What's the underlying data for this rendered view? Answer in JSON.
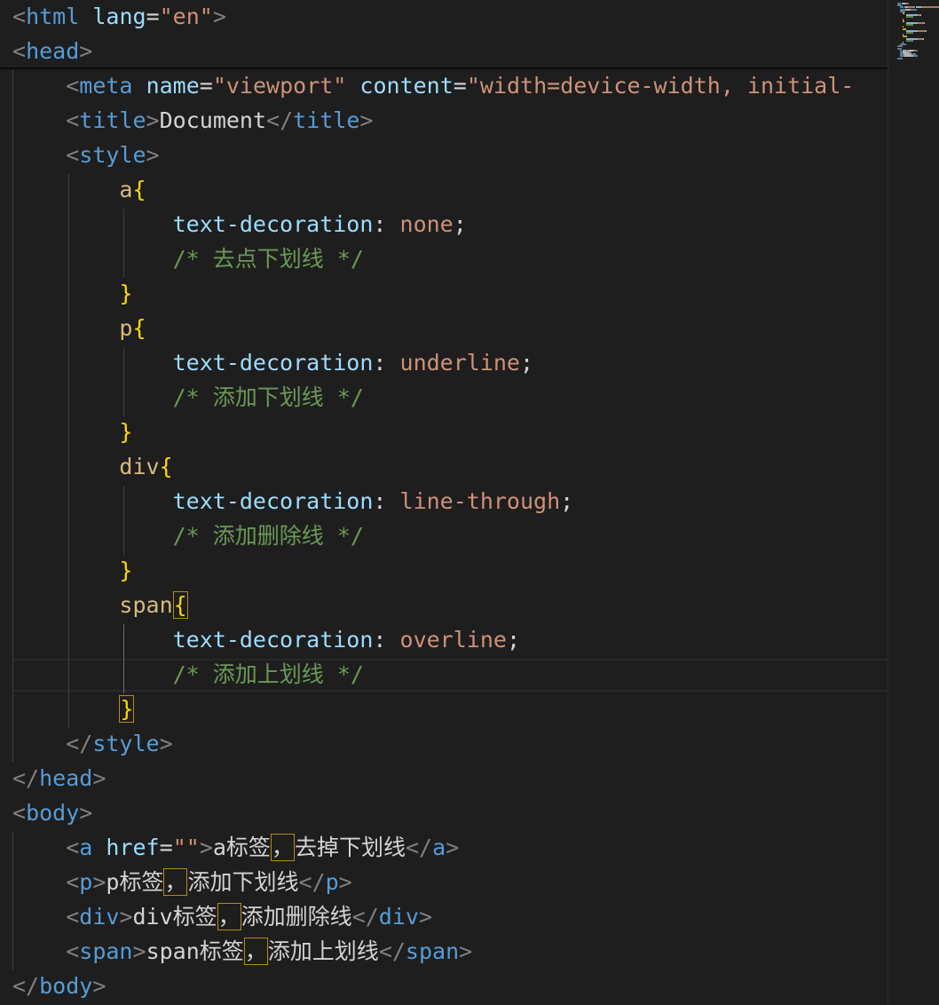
{
  "editor": {
    "lines": [
      [
        [
          "t-punc",
          "<"
        ],
        [
          "t-tag",
          "html"
        ],
        [
          "t-text",
          " "
        ],
        [
          "t-attr",
          "lang"
        ],
        [
          "t-text",
          "="
        ],
        [
          "t-str",
          "\"en\""
        ],
        [
          "t-punc",
          ">"
        ]
      ],
      [
        [
          "t-punc",
          "<"
        ],
        [
          "t-tag",
          "head"
        ],
        [
          "t-punc",
          ">"
        ]
      ],
      [
        [
          "t-text",
          "    "
        ],
        [
          "t-punc",
          "<"
        ],
        [
          "t-tag",
          "meta"
        ],
        [
          "t-text",
          " "
        ],
        [
          "t-attr",
          "name"
        ],
        [
          "t-text",
          "="
        ],
        [
          "t-str",
          "\"viewport\""
        ],
        [
          "t-text",
          " "
        ],
        [
          "t-attr",
          "content"
        ],
        [
          "t-text",
          "="
        ],
        [
          "t-str",
          "\"width=device-width, initial-"
        ]
      ],
      [
        [
          "t-text",
          "    "
        ],
        [
          "t-punc",
          "<"
        ],
        [
          "t-tag",
          "title"
        ],
        [
          "t-punc",
          ">"
        ],
        [
          "t-text",
          "Document"
        ],
        [
          "t-punc",
          "</"
        ],
        [
          "t-tag",
          "title"
        ],
        [
          "t-punc",
          ">"
        ]
      ],
      [
        [
          "t-text",
          "    "
        ],
        [
          "t-punc",
          "<"
        ],
        [
          "t-tag",
          "style"
        ],
        [
          "t-punc",
          ">"
        ]
      ],
      [
        [
          "t-text",
          "        "
        ],
        [
          "t-sel",
          "a"
        ],
        [
          "t-b1",
          "{"
        ]
      ],
      [
        [
          "t-text",
          "            "
        ],
        [
          "t-prop",
          "text-decoration"
        ],
        [
          "t-text",
          ": "
        ],
        [
          "t-val",
          "none"
        ],
        [
          "t-text",
          ";"
        ]
      ],
      [
        [
          "t-text",
          "            "
        ],
        [
          "t-com",
          "/* 去点下划线 */"
        ]
      ],
      [
        [
          "t-text",
          "        "
        ],
        [
          "t-b1",
          "}"
        ]
      ],
      [
        [
          "t-text",
          "        "
        ],
        [
          "t-sel",
          "p"
        ],
        [
          "t-b1",
          "{"
        ]
      ],
      [
        [
          "t-text",
          "            "
        ],
        [
          "t-prop",
          "text-decoration"
        ],
        [
          "t-text",
          ": "
        ],
        [
          "t-val",
          "underline"
        ],
        [
          "t-text",
          ";"
        ]
      ],
      [
        [
          "t-text",
          "            "
        ],
        [
          "t-com",
          "/* 添加下划线 */"
        ]
      ],
      [
        [
          "t-text",
          "        "
        ],
        [
          "t-b1",
          "}"
        ]
      ],
      [
        [
          "t-text",
          "        "
        ],
        [
          "t-sel",
          "div"
        ],
        [
          "t-b1",
          "{"
        ]
      ],
      [
        [
          "t-text",
          "            "
        ],
        [
          "t-prop",
          "text-decoration"
        ],
        [
          "t-text",
          ": "
        ],
        [
          "t-val",
          "line-through"
        ],
        [
          "t-text",
          ";"
        ]
      ],
      [
        [
          "t-text",
          "            "
        ],
        [
          "t-com",
          "/* 添加删除线 */"
        ]
      ],
      [
        [
          "t-text",
          "        "
        ],
        [
          "t-b1",
          "}"
        ]
      ],
      [
        [
          "t-text",
          "        "
        ],
        [
          "t-sel",
          "span"
        ],
        [
          "t-b1 bh",
          "{"
        ]
      ],
      [
        [
          "t-text",
          "            "
        ],
        [
          "t-prop",
          "text-decoration"
        ],
        [
          "t-text",
          ": "
        ],
        [
          "t-val",
          "overline"
        ],
        [
          "t-text",
          ";"
        ]
      ],
      [
        [
          "t-text",
          "            "
        ],
        [
          "t-com",
          "/* 添加上划线 */"
        ]
      ],
      [
        [
          "t-text",
          "        "
        ],
        [
          "t-b1 bh",
          "}"
        ]
      ],
      [
        [
          "t-text",
          "    "
        ],
        [
          "t-punc",
          "</"
        ],
        [
          "t-tag",
          "style"
        ],
        [
          "t-punc",
          ">"
        ]
      ],
      [
        [
          "t-punc",
          "</"
        ],
        [
          "t-tag",
          "head"
        ],
        [
          "t-punc",
          ">"
        ]
      ],
      [
        [
          "t-punc",
          "<"
        ],
        [
          "t-tag",
          "body"
        ],
        [
          "t-punc",
          ">"
        ]
      ],
      [
        [
          "t-text",
          "    "
        ],
        [
          "t-punc",
          "<"
        ],
        [
          "t-tag",
          "a"
        ],
        [
          "t-text",
          " "
        ],
        [
          "t-attr",
          "href"
        ],
        [
          "t-text",
          "="
        ],
        [
          "t-str",
          "\"\""
        ],
        [
          "t-punc",
          ">"
        ],
        [
          "t-text",
          "a标签"
        ],
        [
          "t-text bh",
          "，"
        ],
        [
          "t-text",
          "去掉下划线"
        ],
        [
          "t-punc",
          "</"
        ],
        [
          "t-tag",
          "a"
        ],
        [
          "t-punc",
          ">"
        ]
      ],
      [
        [
          "t-text",
          "    "
        ],
        [
          "t-punc",
          "<"
        ],
        [
          "t-tag",
          "p"
        ],
        [
          "t-punc",
          ">"
        ],
        [
          "t-text",
          "p标签"
        ],
        [
          "t-text bh",
          "，"
        ],
        [
          "t-text",
          "添加下划线"
        ],
        [
          "t-punc",
          "</"
        ],
        [
          "t-tag",
          "p"
        ],
        [
          "t-punc",
          ">"
        ]
      ],
      [
        [
          "t-text",
          "    "
        ],
        [
          "t-punc",
          "<"
        ],
        [
          "t-tag",
          "div"
        ],
        [
          "t-punc",
          ">"
        ],
        [
          "t-text",
          "div标签"
        ],
        [
          "t-text bh",
          "，"
        ],
        [
          "t-text",
          "添加删除线"
        ],
        [
          "t-punc",
          "</"
        ],
        [
          "t-tag",
          "div"
        ],
        [
          "t-punc",
          ">"
        ]
      ],
      [
        [
          "t-text",
          "    "
        ],
        [
          "t-punc",
          "<"
        ],
        [
          "t-tag",
          "span"
        ],
        [
          "t-punc",
          ">"
        ],
        [
          "t-text",
          "span标签"
        ],
        [
          "t-text bh",
          "，"
        ],
        [
          "t-text",
          "添加上划线"
        ],
        [
          "t-punc",
          "</"
        ],
        [
          "t-tag",
          "span"
        ],
        [
          "t-punc",
          ">"
        ]
      ],
      [
        [
          "t-punc",
          "</"
        ],
        [
          "t-tag",
          "body"
        ],
        [
          "t-punc",
          ">"
        ]
      ]
    ]
  },
  "colors": {
    "background": "#1e1e1e",
    "tag": "#569cd6",
    "attribute": "#9cdcfe",
    "string": "#ce9178",
    "comment": "#6a9955",
    "selector": "#d7ba7d",
    "bracket": "#ffd700",
    "bracket_match_border": "#b18b16"
  }
}
